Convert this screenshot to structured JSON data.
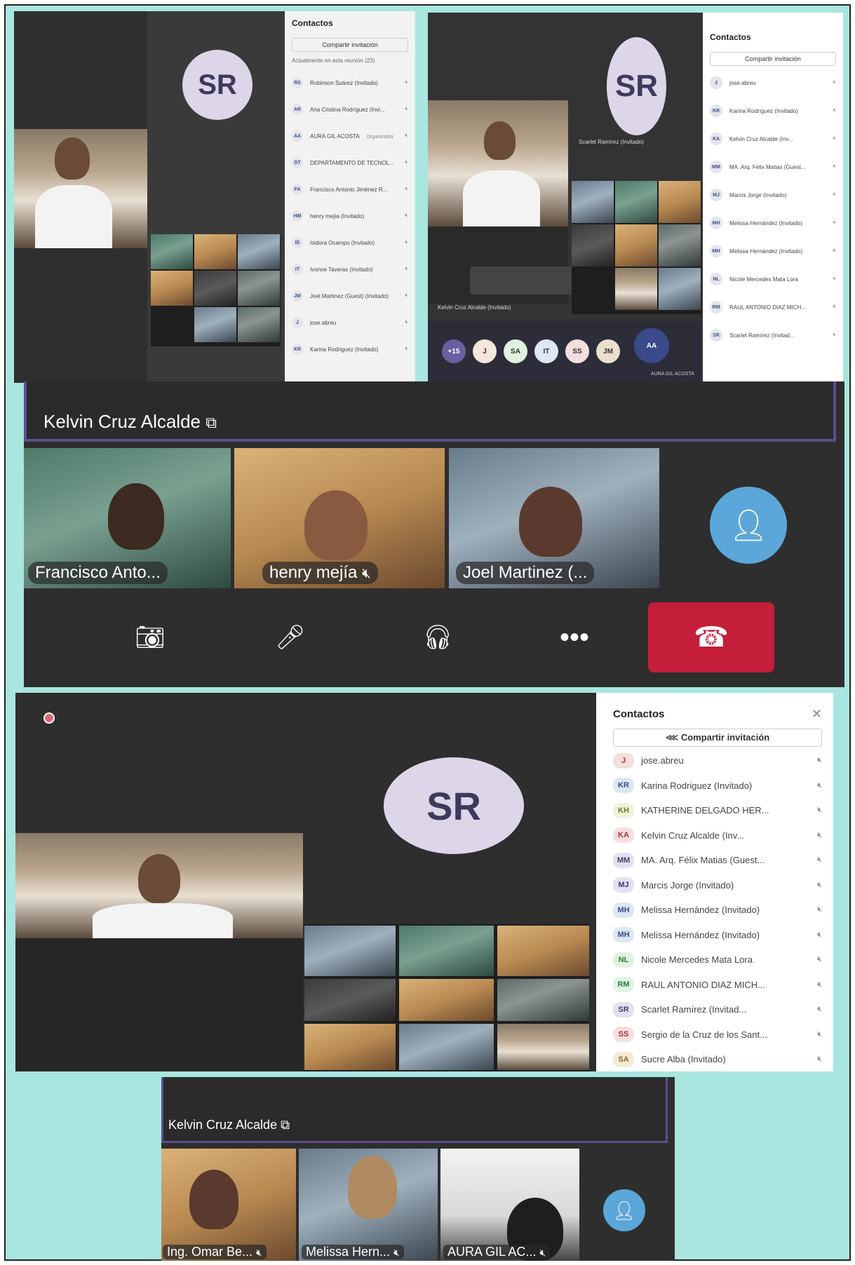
{
  "panel1": {
    "avatar": "SR",
    "contacts_title": "Contactos",
    "share_label": "Compartir invitación",
    "section_label": "Actualmente en esta reunión (23)",
    "contacts": [
      {
        "ini": "RS",
        "name": "Robinson Suárez (Invitado)"
      },
      {
        "ini": "AR",
        "name": "Ana Cristina Rodríguez (Invi..."
      },
      {
        "ini": "AA",
        "name": "AURA GIL ACOSTA",
        "sub": "Organizador"
      },
      {
        "ini": "DT",
        "name": "DEPARTAMENTO DE TECNOL..."
      },
      {
        "ini": "FA",
        "name": "Francisco Antonio Jiménez R..."
      },
      {
        "ini": "HM",
        "name": "henry mejía (Invitado)"
      },
      {
        "ini": "ID",
        "name": "Isidora Ocampo (Invitado)"
      },
      {
        "ini": "IT",
        "name": "Ivonne Taveras (Invitado)"
      },
      {
        "ini": "JM",
        "name": "Joel Martinez (Guest) (Invitado)"
      },
      {
        "ini": "J",
        "name": "jose.abreu"
      },
      {
        "ini": "KR",
        "name": "Karina Rodriguez (Invitado)"
      }
    ]
  },
  "panel2": {
    "avatar": "SR",
    "contacts_title": "Contactos",
    "share_label": "Compartir invitación",
    "tile_label_1": "Scarlet Ramírez (Invitado)",
    "tile_label_2": "Kelvin Cruz Alcalde (Invitado)",
    "bottom_avatars": [
      "+15",
      "J",
      "SA",
      "IT",
      "SS",
      "JM",
      "AA"
    ],
    "aa_label": "AURA GIL ACOSTA",
    "contacts": [
      {
        "ini": "J",
        "name": "jose.abreu"
      },
      {
        "ini": "KR",
        "name": "Karina Rodríguez (Invitado)"
      },
      {
        "ini": "KA",
        "name": "Kelvin Cruz Alcalde (Inv..."
      },
      {
        "ini": "MM",
        "name": "MA. Arq. Félix Matias (Guest..."
      },
      {
        "ini": "MJ",
        "name": "Marcis Jorge (Invitado)"
      },
      {
        "ini": "MH",
        "name": "Melissa Hernández (Invitado)"
      },
      {
        "ini": "MH",
        "name": "Melissa Hernández (Invitado)"
      },
      {
        "ini": "NL",
        "name": "Nicole Mercedes Mata Lora"
      },
      {
        "ini": "RM",
        "name": "RAUL ANTONIO DIAZ MICH..."
      },
      {
        "ini": "SR",
        "name": "Scarlet Ramírez (Invitad..."
      }
    ]
  },
  "panel3": {
    "title": "Kelvin Cruz Alcalde",
    "tiles": [
      "Francisco Anto...",
      "henry mejía",
      "Joel Martinez (..."
    ]
  },
  "panel4": {
    "avatar": "SR",
    "contacts_title": "Contactos",
    "share_label": "Compartir invitación",
    "contacts": [
      {
        "ini": "J",
        "name": "jose.abreu",
        "bg": "#f3dede",
        "fg": "#b03030"
      },
      {
        "ini": "KR",
        "name": "Karina Rodriguez (Invitado)",
        "bg": "#dde6f3",
        "fg": "#30508a"
      },
      {
        "ini": "KH",
        "name": "KATHERINE DELGADO HER...",
        "bg": "#f0f3d8",
        "fg": "#6b7a20"
      },
      {
        "ini": "KA",
        "name": "Kelvin Cruz Alcalde (Inv...",
        "bg": "#f6dede",
        "fg": "#b03030"
      },
      {
        "ini": "MM",
        "name": "MA. Arq. Félix Matias (Guest...",
        "bg": "#e2e2ee",
        "fg": "#404070"
      },
      {
        "ini": "MJ",
        "name": "Marcis Jorge (Invitado)",
        "bg": "#e2e0f3",
        "fg": "#3d3880"
      },
      {
        "ini": "MH",
        "name": "Melissa Hernández (Invitado)",
        "bg": "#dde6f3",
        "fg": "#30508a"
      },
      {
        "ini": "MH",
        "name": "Melissa Hernández (Invitado)",
        "bg": "#dde6f3",
        "fg": "#30508a"
      },
      {
        "ini": "NL",
        "name": "Nicole Mercedes Mata Lora",
        "bg": "#dff2df",
        "fg": "#2f7a2f"
      },
      {
        "ini": "RM",
        "name": "RAUL ANTONIO DIAZ MICH...",
        "bg": "#dff2e6",
        "fg": "#2f7a4a"
      },
      {
        "ini": "SR",
        "name": "Scarlet Ramírez (Invitad...",
        "bg": "#e2e2ee",
        "fg": "#404070"
      },
      {
        "ini": "SS",
        "name": "Sergio de la Cruz de los Sant...",
        "bg": "#f6dedf",
        "fg": "#a03040"
      },
      {
        "ini": "SA",
        "name": "Sucre Alba (Invitado)",
        "bg": "#f3ead8",
        "fg": "#8a6a20"
      }
    ]
  },
  "panel5": {
    "title": "Kelvin Cruz Alcalde",
    "tiles": [
      "Ing. Omar Be...",
      "Melissa Hern...",
      "AURA GIL AC..."
    ]
  },
  "colors": {
    "frame_bg": "#a8e6df",
    "hangup": "#c41e3a",
    "accent": "#5ba7d9",
    "title_border": "#5a4f8c"
  }
}
